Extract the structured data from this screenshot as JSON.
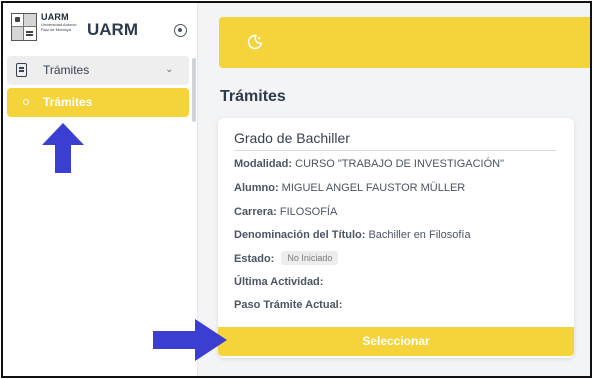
{
  "brand": {
    "abbr": "UARM",
    "full_name": "Universidad Antonio Ruiz de Montoya",
    "title": "UARM"
  },
  "sidebar": {
    "group_label": "Trámites",
    "active_item_label": "Trámites"
  },
  "main": {
    "page_title": "Trámites"
  },
  "card": {
    "title": "Grado de Bachiller",
    "fields": [
      {
        "key": "Modalidad:",
        "value": "CURSO \"TRABAJO DE INVESTIGACIÓN\""
      },
      {
        "key": "Alumno:",
        "value": "MIGUEL ANGEL FAUSTOR MÜLLER"
      },
      {
        "key": "Carrera:",
        "value": "FILOSOFÍA"
      },
      {
        "key": "Denominación del Título:",
        "value": "Bachiller en Filosofía"
      },
      {
        "key": "Estado:",
        "value": "No Iniciado"
      },
      {
        "key": "Última Actividad:",
        "value": ""
      },
      {
        "key": "Paso Trámite Actual:",
        "value": ""
      }
    ],
    "button_label": "Seleccionar"
  },
  "colors": {
    "accent": "#f5d33a",
    "annotation_arrow": "#3b3fd1"
  }
}
